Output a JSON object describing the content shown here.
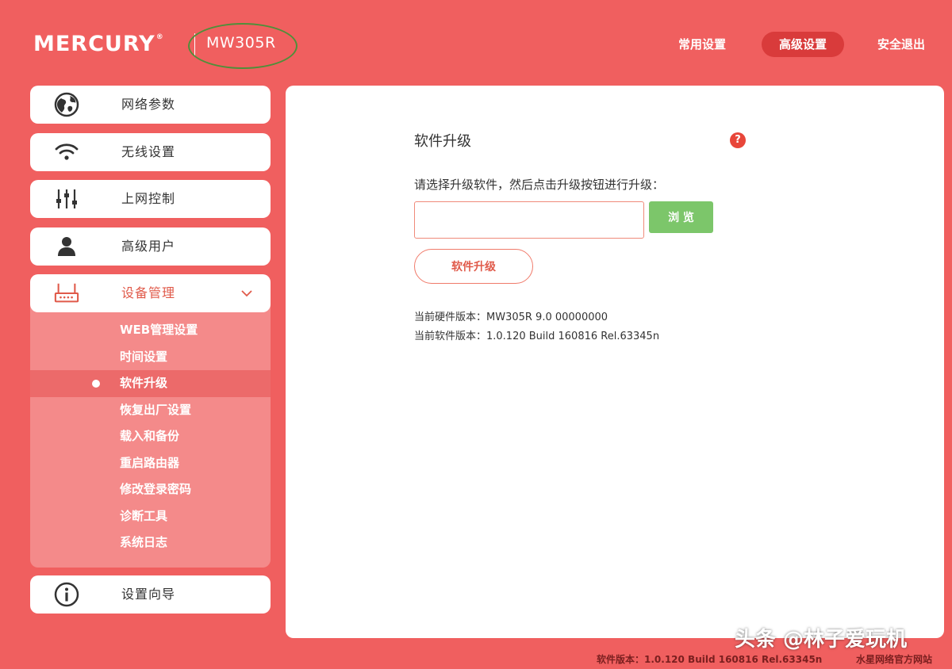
{
  "header": {
    "brand": "MERCURY",
    "brand_mark": "®",
    "model": "MW305R",
    "nav": {
      "common": "常用设置",
      "advanced": "高级设置",
      "logout": "安全退出"
    }
  },
  "sidebar": {
    "items": [
      {
        "label": "网络参数",
        "icon": "globe-icon"
      },
      {
        "label": "无线设置",
        "icon": "wifi-icon"
      },
      {
        "label": "上网控制",
        "icon": "sliders-icon"
      },
      {
        "label": "高级用户",
        "icon": "user-icon"
      },
      {
        "label": "设备管理",
        "icon": "router-icon"
      },
      {
        "label": "设置向导",
        "icon": "info-icon"
      }
    ],
    "sub_items": [
      "WEB管理设置",
      "时间设置",
      "软件升级",
      "恢复出厂设置",
      "载入和备份",
      "重启路由器",
      "修改登录密码",
      "诊断工具",
      "系统日志"
    ],
    "active_sub": "软件升级"
  },
  "main": {
    "title": "软件升级",
    "help_symbol": "?",
    "instruction": "请选择升级软件，然后点击升级按钮进行升级：",
    "file_value": "",
    "browse_label": "浏 览",
    "upgrade_label": "软件升级",
    "hw_version": "当前硬件版本：MW305R 9.0 00000000",
    "sw_version": "当前软件版本：1.0.120 Build 160816 Rel.63345n"
  },
  "footer": {
    "version": "软件版本：1.0.120 Build 160816 Rel.63345n",
    "site": "水星网络官方网站"
  },
  "watermark": "头条 @林子爱玩机",
  "colors": {
    "background": "#f05f5f",
    "submenu_bg": "#f48a8a",
    "active_nav": "#d93b3b",
    "browse_button": "#7cc66a",
    "help_icon": "#e8463a"
  }
}
